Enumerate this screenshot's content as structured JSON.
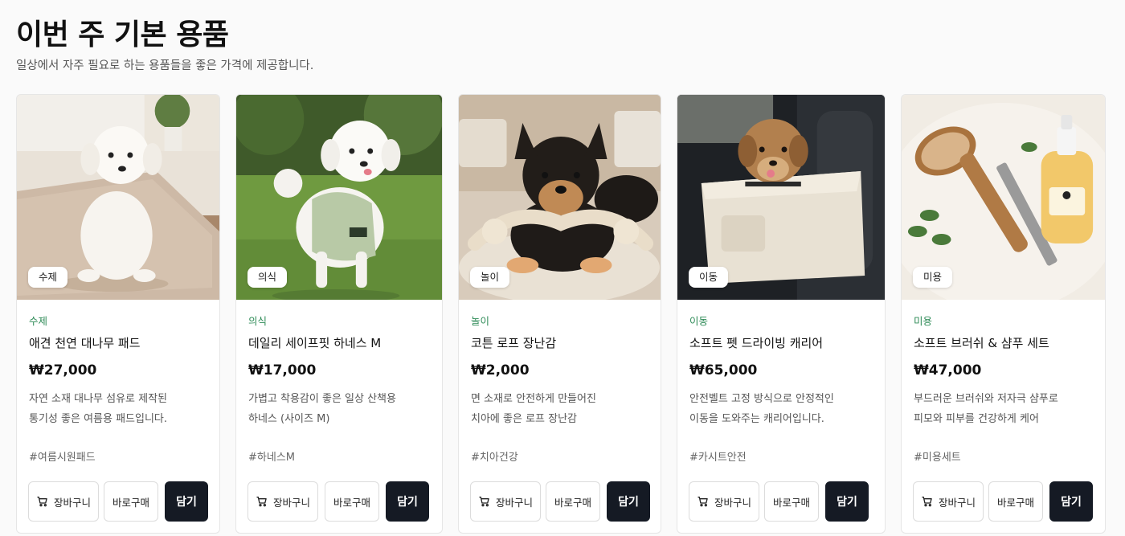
{
  "header": {
    "title": "이번 주 기본 용품",
    "subtitle": "일상에서 자주 필요로 하는 용품들을 좋은 가격에 제공합니다."
  },
  "products": [
    {
      "badge": "수제",
      "category": "수제",
      "name": "애견 천연 대나무 패드",
      "price": "₩27,000",
      "desc_line1": "자연 소재 대나무 섬유로 제작된",
      "desc_line2": "통기성 좋은 여름용 패드입니다.",
      "tag": "#여름시원패드",
      "cart_label": "장바구니",
      "buy_label": "바로구매",
      "add_label": "담기"
    },
    {
      "badge": "의식",
      "category": "의식",
      "name": "데일리 세이프핏 하네스 M",
      "price": "₩17,000",
      "desc_line1": "가볍고 착용감이 좋은 일상 산책용",
      "desc_line2": "하네스 (사이즈 M)",
      "tag": "#하네스M",
      "cart_label": "장바구니",
      "buy_label": "바로구매",
      "add_label": "담기"
    },
    {
      "badge": "놀이",
      "category": "놀이",
      "name": "코튼 로프 장난감",
      "price": "₩2,000",
      "desc_line1": "면 소재로 안전하게 만들어진",
      "desc_line2": "치아에 좋은 로프 장난감",
      "tag": "#치아건강",
      "cart_label": "장바구니",
      "buy_label": "바로구매",
      "add_label": "담기"
    },
    {
      "badge": "이동",
      "category": "이동",
      "name": "소프트 펫 드라이빙 캐리어",
      "price": "₩65,000",
      "desc_line1": "안전벨트 고정 방식으로 안정적인",
      "desc_line2": "이동을 도와주는 캐리어입니다.",
      "tag": "#카시트안전",
      "cart_label": "장바구니",
      "buy_label": "바로구매",
      "add_label": "담기"
    },
    {
      "badge": "미용",
      "category": "미용",
      "name": "소프트 브러쉬 & 샴푸 세트",
      "price": "₩47,000",
      "desc_line1": "부드러운 브러쉬와 저자극 샴푸로",
      "desc_line2": "피모와 피부를 건강하게 케어",
      "tag": "#미용세트",
      "cart_label": "장바구니",
      "buy_label": "바로구매",
      "add_label": "담기"
    }
  ],
  "colors": {
    "category_text": "#2e8b57",
    "primary_button": "#151a24"
  }
}
